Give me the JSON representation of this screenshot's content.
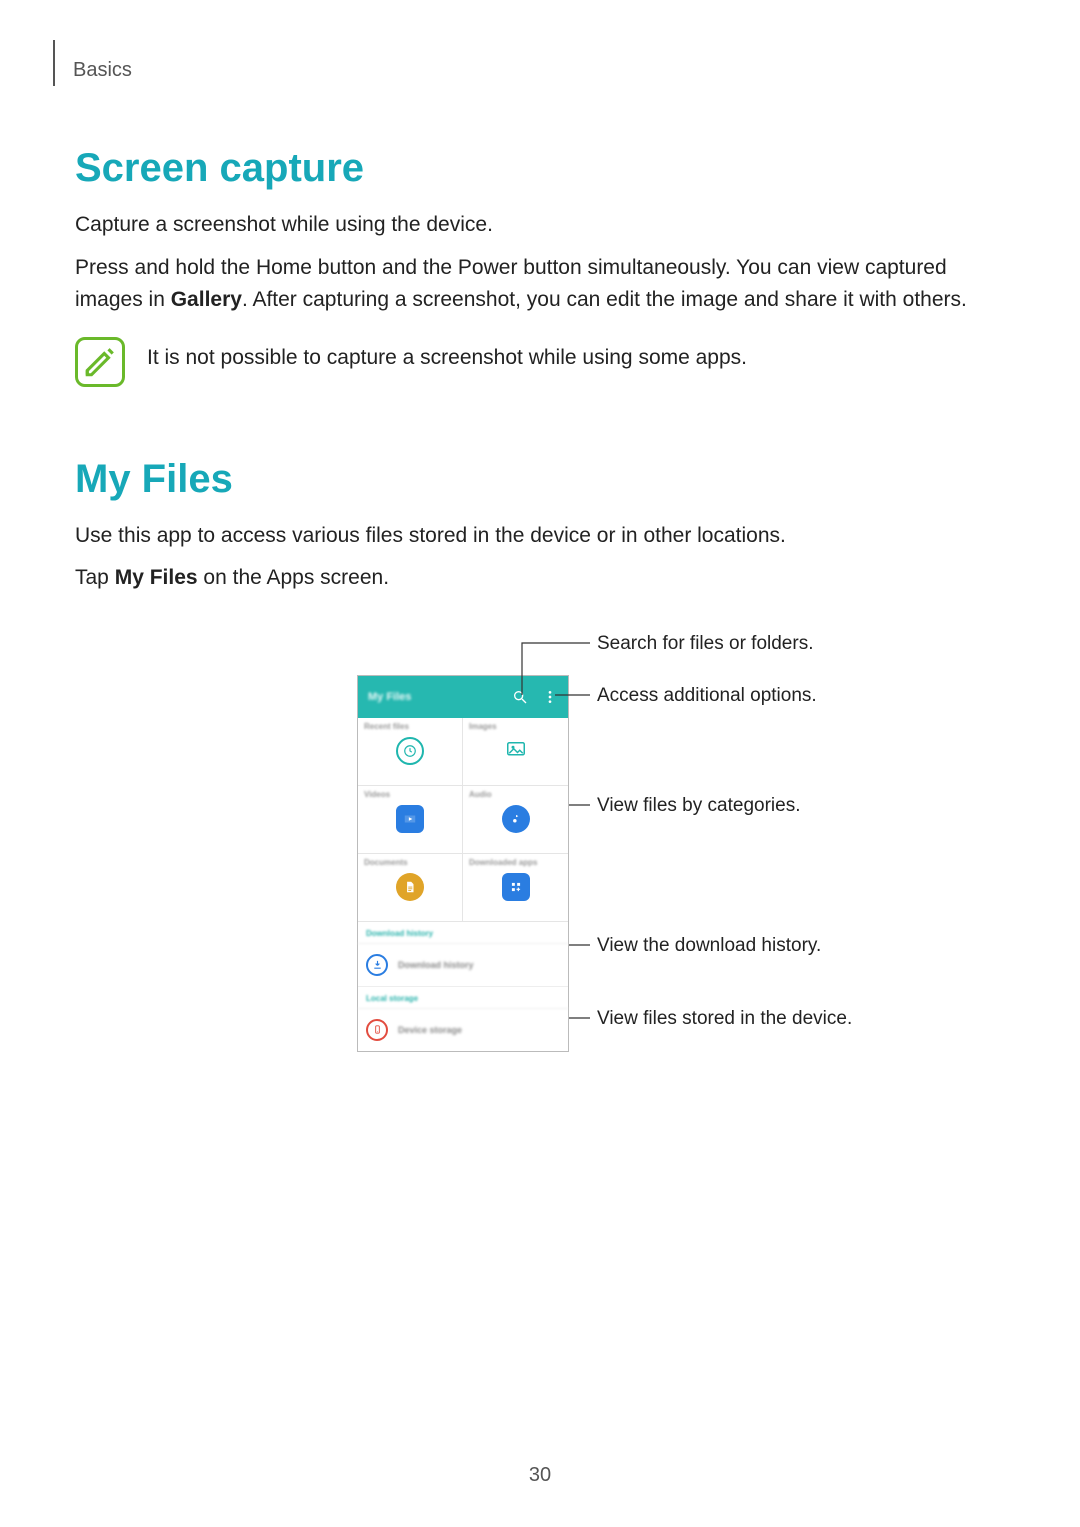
{
  "breadcrumb": "Basics",
  "section1": {
    "heading": "Screen capture",
    "p1": "Capture a screenshot while using the device.",
    "p2_a": "Press and hold the Home button and the Power button simultaneously. You can view captured images in ",
    "p2_bold": "Gallery",
    "p2_b": ". After capturing a screenshot, you can edit the image and share it with others.",
    "note": "It is not possible to capture a screenshot while using some apps."
  },
  "section2": {
    "heading": "My Files",
    "p1": "Use this app to access various files stored in the device or in other locations.",
    "p2_a": "Tap ",
    "p2_bold": "My Files",
    "p2_b": " on the Apps screen."
  },
  "phone": {
    "title": "My Files",
    "categories": [
      {
        "label": "Recent files",
        "color": "#1fb6ae",
        "icon": "clock"
      },
      {
        "label": "Images",
        "color": "#1fb6ae",
        "icon": "image",
        "square": true
      },
      {
        "label": "Videos",
        "color": "#2a7de1",
        "icon": "video"
      },
      {
        "label": "Audio",
        "color": "#2a7de1",
        "icon": "music"
      },
      {
        "label": "Documents",
        "color": "#e0a428",
        "icon": "doc"
      },
      {
        "label": "Downloaded apps",
        "color": "#2a7de1",
        "icon": "apps"
      }
    ],
    "download_section_label": "Download history",
    "download_row": "Download history",
    "local_section_label": "Local storage",
    "device_row": "Device storage"
  },
  "callouts": {
    "search": "Search for files or folders.",
    "options": "Access additional options.",
    "categories": "View files by categories.",
    "download": "View the download history.",
    "device": "View files stored in the device."
  },
  "page_number": "30"
}
